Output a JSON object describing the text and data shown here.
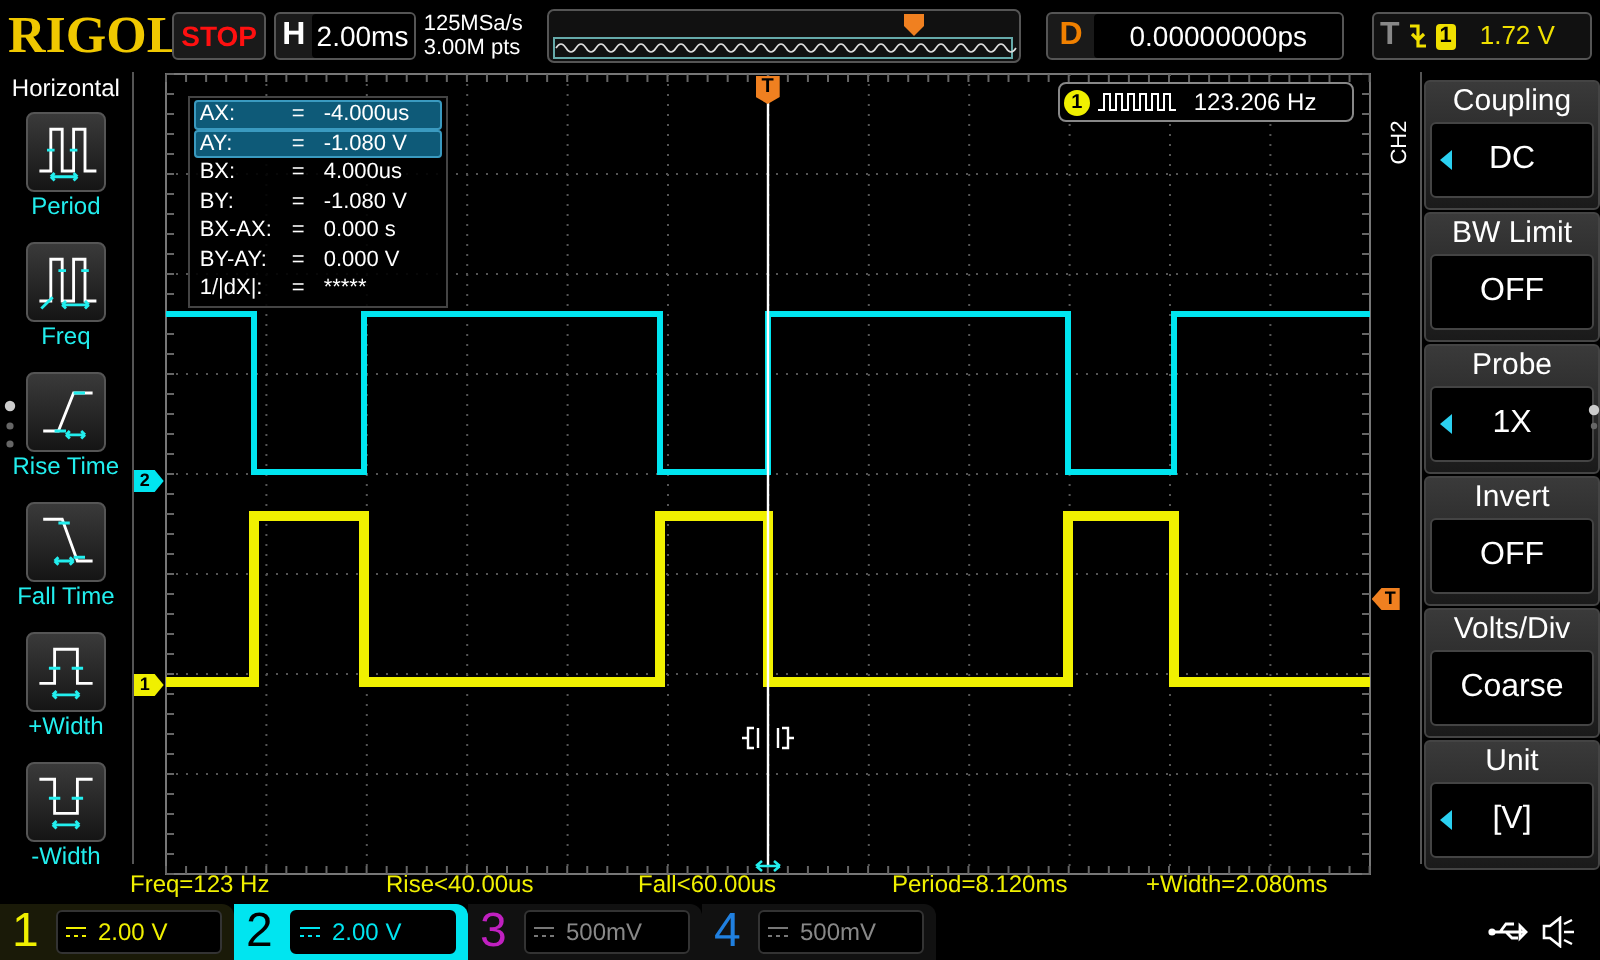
{
  "top_bar": {
    "logo": "RIGOL",
    "run_state": "STOP",
    "timebase": {
      "label": "H",
      "value": "2.00ms"
    },
    "sample_rate": "125MSa/s",
    "memory_depth": "3.00M pts",
    "delay": {
      "label": "D",
      "value": "0.00000000ps"
    },
    "trigger": {
      "label": "T",
      "source": "1",
      "level": "1.72 V"
    }
  },
  "measure_menu": {
    "title": "Horizontal",
    "items": [
      {
        "label": "Period",
        "kind": "period"
      },
      {
        "label": "Freq",
        "kind": "freq"
      },
      {
        "label": "Rise Time",
        "kind": "rise"
      },
      {
        "label": "Fall Time",
        "kind": "fall"
      },
      {
        "label": "+Width",
        "kind": "pwidth"
      },
      {
        "label": "-Width",
        "kind": "nwidth"
      }
    ]
  },
  "cursor_table": [
    {
      "name": "AX:",
      "value": "-4.000us",
      "selected": true
    },
    {
      "name": "AY:",
      "value": "-1.080 V",
      "selected": true
    },
    {
      "name": "BX:",
      "value": "4.000us",
      "selected": false
    },
    {
      "name": "BY:",
      "value": "-1.080 V",
      "selected": false
    },
    {
      "name": "BX-AX:",
      "value": "0.000 s",
      "selected": false
    },
    {
      "name": "BY-AY:",
      "value": "0.000 V",
      "selected": false
    },
    {
      "name": "1/|dX|:",
      "value": "*****",
      "selected": false
    }
  ],
  "cursor_equals": "=",
  "frequency_counter": {
    "channel": "1",
    "value": "123.206 Hz"
  },
  "markers": {
    "trigger_position": "T",
    "trigger_level": "T",
    "ch1": "1",
    "ch2": "2"
  },
  "measurements": [
    "Freq=123 Hz",
    "Rise<40.00us",
    "Fall<60.00us",
    "Period=8.120ms",
    "+Width=2.080ms"
  ],
  "channels": [
    {
      "number": "1",
      "scale": "2.00 V",
      "color": "#f0f000",
      "enabled": true,
      "selected": false
    },
    {
      "number": "2",
      "scale": "2.00 V",
      "color": "#00e5f0",
      "enabled": true,
      "selected": true
    },
    {
      "number": "3",
      "scale": "500mV",
      "color": "#c020c0",
      "enabled": false,
      "selected": false
    },
    {
      "number": "4",
      "scale": "500mV",
      "color": "#2080e0",
      "enabled": false,
      "selected": false
    }
  ],
  "channel_menu": {
    "title": "CH2",
    "items": [
      {
        "label": "Coupling",
        "value": "DC",
        "kind": "cycle"
      },
      {
        "label": "BW Limit",
        "value": "OFF",
        "kind": "toggle"
      },
      {
        "label": "Probe",
        "value": "1X",
        "kind": "cycle"
      },
      {
        "label": "Invert",
        "value": "OFF",
        "kind": "toggle"
      },
      {
        "label": "Volts/Div",
        "value": "Coarse",
        "kind": "toggle"
      },
      {
        "label": "Unit",
        "value": "[V]",
        "kind": "cycle"
      }
    ]
  }
}
